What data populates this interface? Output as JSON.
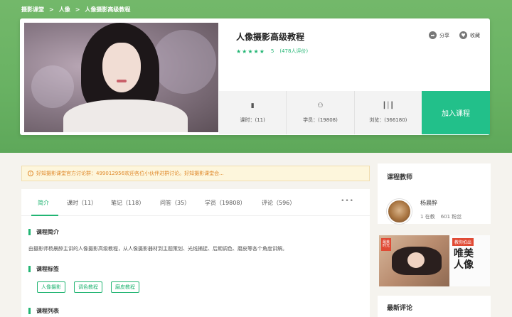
{
  "breadcrumb": [
    "摄影课堂",
    "人像",
    "人像摄影高级教程"
  ],
  "breadcrumb_sep": ">",
  "course": {
    "title": "人像摄影高级教程",
    "stars": "★★★★★",
    "score": "5",
    "reviews": "(478人评价)"
  },
  "actions": {
    "share": "分享",
    "favorite": "收藏"
  },
  "stats": [
    {
      "label": "课时：(11)",
      "icon": "book-icon"
    },
    {
      "label": "学员：(19808)",
      "icon": "users-icon"
    },
    {
      "label": "浏览：(366180)",
      "icon": "audio-wave-icon"
    }
  ],
  "join_label": "加入课程",
  "notice": "好知摄影课堂官方讨论群：499012956欢迎各位小伙伴进群讨论。好知摄影课堂会...",
  "tabs": [
    "简介",
    "课时（11）",
    "笔记（118）",
    "问答（35）",
    "学员（19808）",
    "评论（596）"
  ],
  "more": "•••",
  "sections": {
    "intro_title": "课程简介",
    "intro_text": "由摄影师杨晨醉主讲的人像摄影高级教程，从人像摄影器材到主题策划、光线捕捉、后期调色、磨皮等各个角度讲解。",
    "tags_title": "课程标签",
    "tags": [
      "人像摄影",
      "调色教程",
      "磨皮教程"
    ],
    "list_title": "课程列表"
  },
  "teacher": {
    "heading": "课程教师",
    "name": "杨晨醉",
    "courses": "1 在教",
    "fans": "601 粉丝"
  },
  "ad": {
    "badge": "教你拍出",
    "slogan_line1": "唯美",
    "slogan_line2": "人像",
    "corner": "最美时光"
  },
  "latest_comments": "最新评论"
}
